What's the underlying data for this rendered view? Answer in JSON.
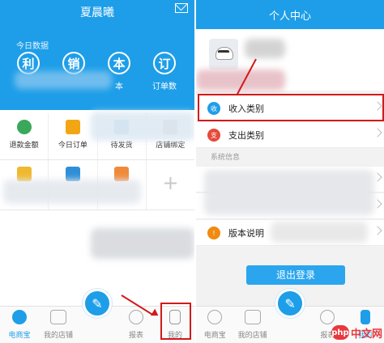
{
  "left": {
    "title": "夏晨曦",
    "today_label": "今日数据",
    "stats": [
      {
        "glyph": "利",
        "label": ""
      },
      {
        "glyph": "销",
        "label": ""
      },
      {
        "glyph": "本",
        "label": "本"
      },
      {
        "glyph": "订",
        "label": "订单数"
      }
    ],
    "grid_row1": [
      "退款金额",
      "今日订单",
      "待发货",
      "店铺绑定"
    ],
    "grid_plus": "+",
    "tabs": [
      "电商宝",
      "我的店铺",
      "",
      "报表",
      "我的"
    ],
    "fab_glyph": "✎"
  },
  "right": {
    "title": "个人中心",
    "rows": [
      {
        "icon_text": "收",
        "label": "收入类别",
        "color": "#1e9ee8"
      },
      {
        "icon_text": "支",
        "label": "支出类别",
        "color": "#e54a3a"
      }
    ],
    "section_label": "系统信息",
    "about": {
      "icon_text": "!",
      "label": "版本说明",
      "color": "#f08a10"
    },
    "logout_label": "退出登录",
    "tabs": [
      "电商宝",
      "我的店铺",
      "",
      "报表",
      "我的"
    ]
  },
  "watermark": {
    "logo": "php",
    "text": "中文网"
  },
  "colors": {
    "accent": "#1e9ee8",
    "highlight": "#d21a1a"
  }
}
